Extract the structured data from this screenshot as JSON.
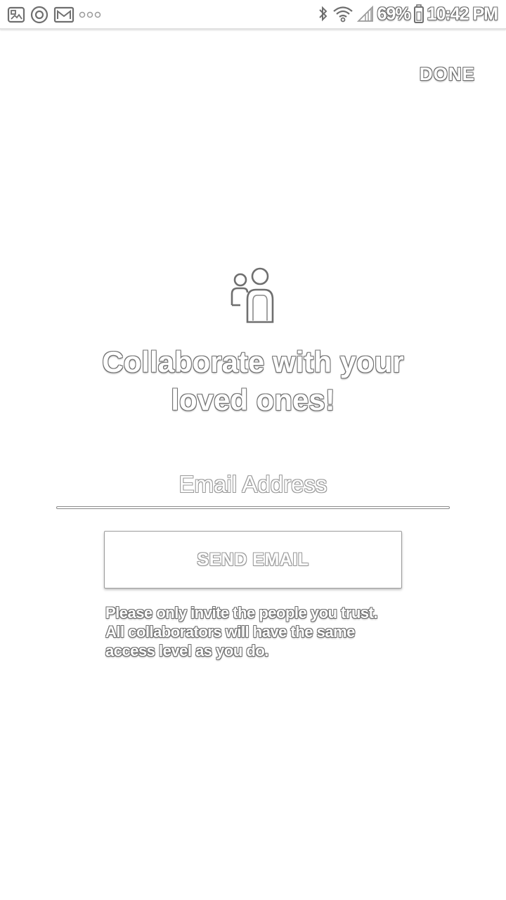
{
  "status_bar": {
    "left_icons": [
      "image-notification-icon",
      "target-notification-icon",
      "gmail-notification-icon",
      "more-notifications-icon"
    ],
    "right_icons": [
      "bluetooth-icon",
      "wifi-icon",
      "signal-icon",
      "battery-icon"
    ],
    "battery_percent": "69%",
    "time": "10:42 PM"
  },
  "toolbar": {
    "done_label": "DONE"
  },
  "main": {
    "icon": "people-icon",
    "headline_line1": "Collaborate with your",
    "headline_line2": "loved ones!",
    "email": {
      "placeholder": "Email Address",
      "value": ""
    },
    "send_label": "SEND EMAIL",
    "disclaimer_lines": [
      "Please only invite the people you trust.",
      "All collaborators will have the same",
      "access level as you do."
    ]
  },
  "colors": {
    "background": "#ffffff",
    "outline": "#6f6f6f"
  }
}
